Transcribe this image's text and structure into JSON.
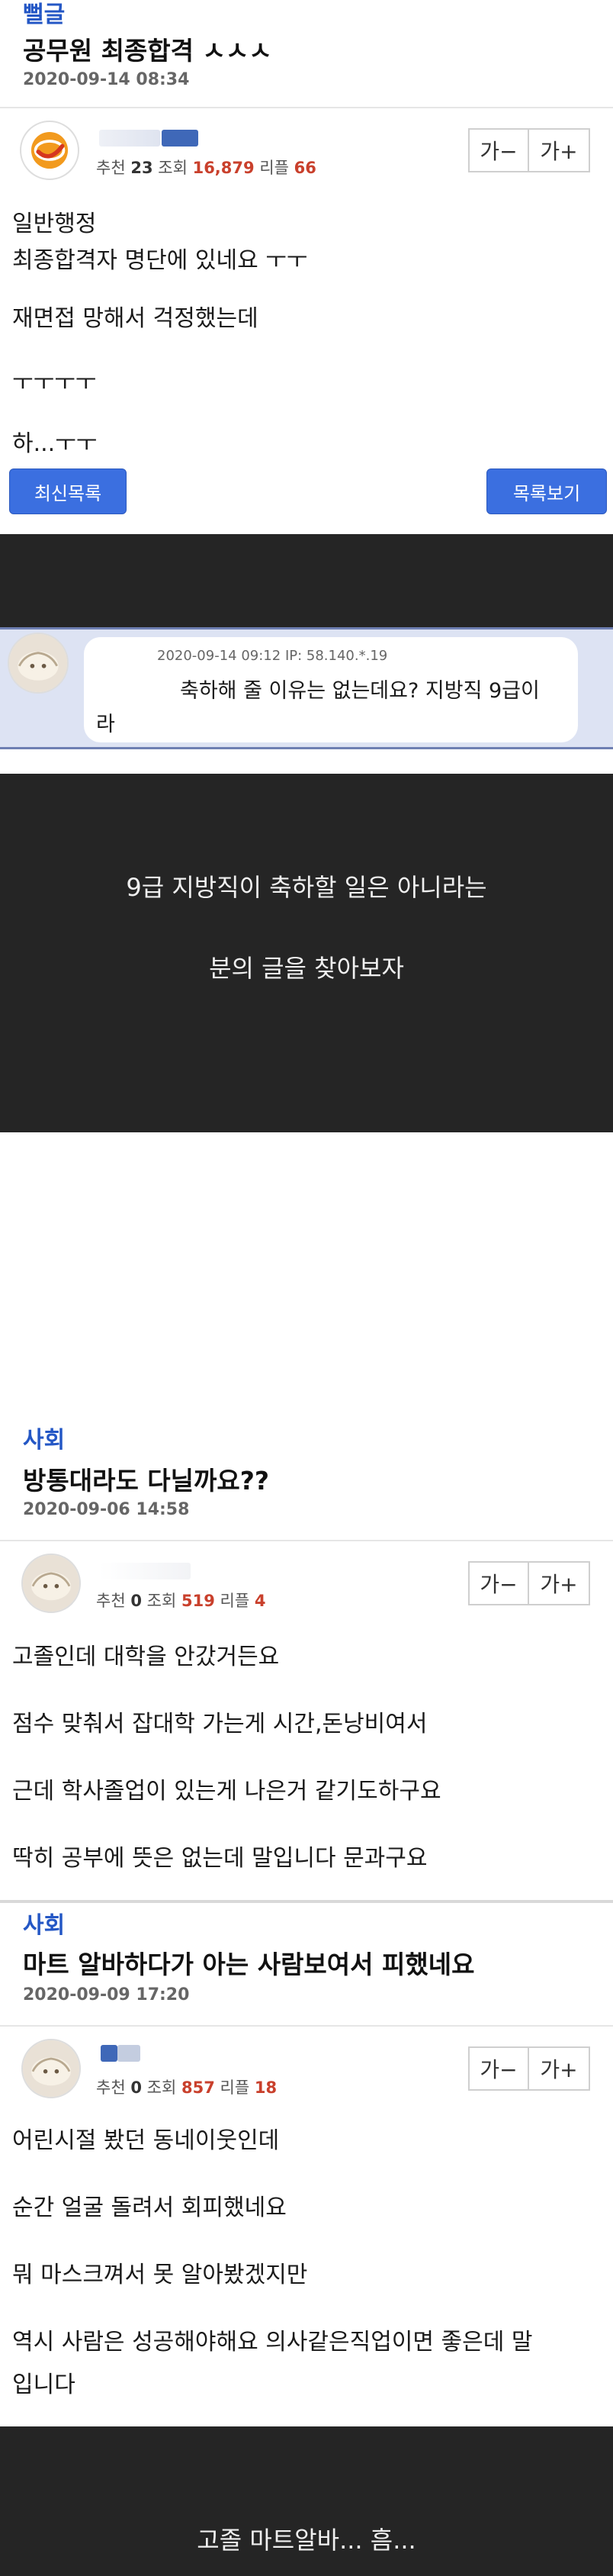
{
  "post1": {
    "category": "뻘글",
    "title": "공무원 최종합격 ㅅㅅㅅ",
    "date": "2020-09-14 08:34",
    "recommend_label": "추천",
    "recommend": "23",
    "views_label": "조회",
    "views": "16,879",
    "replies_label": "리플",
    "replies": "66",
    "font_minus": "가−",
    "font_plus": "가+",
    "lines": [
      "일반행정",
      "최종합격자 명단에 있네요 ㅜㅜ",
      "재면접 망해서 걱정했는데",
      "ㅜㅜㅜㅜ",
      "하...ㅜㅜ"
    ],
    "latest_button": "최신목록",
    "list_button": "목록보기"
  },
  "comment": {
    "datetime": "2020-09-14 09:12",
    "ip": "IP: 58.140.*.19",
    "line1": "축하해 줄 이유는 없는데요? 지방직 9급이",
    "line2": "라"
  },
  "caption1": {
    "line1": "9급 지방직이 축하할 일은 아니라는",
    "line2": "분의 글을 찾아보자"
  },
  "post2": {
    "category": "사회",
    "title": "방통대라도 다닐까요??",
    "date": "2020-09-06 14:58",
    "recommend_label": "추천",
    "recommend": "0",
    "views_label": "조회",
    "views": "519",
    "replies_label": "리플",
    "replies": "4",
    "font_minus": "가−",
    "font_plus": "가+",
    "lines": [
      "고졸인데 대학을 안갔거든요",
      "점수 맞춰서 잡대학 가는게 시간,돈낭비여서",
      "근데 학사졸업이 있는게 나은거 같기도하구요",
      "딱히 공부에 뜻은 없는데 말입니다 문과구요"
    ]
  },
  "post3": {
    "category": "사회",
    "title": "마트 알바하다가 아는 사람보여서 피했네요",
    "date": "2020-09-09 17:20",
    "recommend_label": "추천",
    "recommend": "0",
    "views_label": "조회",
    "views": "857",
    "replies_label": "리플",
    "replies": "18",
    "font_minus": "가−",
    "font_plus": "가+",
    "lines": [
      "어린시절 봤던 동네이웃인데",
      "순간 얼굴 돌려서 회피했네요",
      "뭐 마스크껴서 못 알아봤겠지만",
      "역시 사람은 성공해야해요 의사같은직업이면 좋은데 말",
      "입니다"
    ]
  },
  "caption2": {
    "line1": "고졸 마트알바... 흠..."
  },
  "colors": {
    "accent_blue": "#2457c5",
    "button_blue": "#3b6fe0",
    "red_count": "#c9402c",
    "dark_bg": "#252525",
    "comment_bg": "#dde3f3"
  },
  "icons": {
    "avatar1": "orange-logo-avatar",
    "avatar2": "dumpling-avatar",
    "font_buttons": "font-size-buttons"
  }
}
